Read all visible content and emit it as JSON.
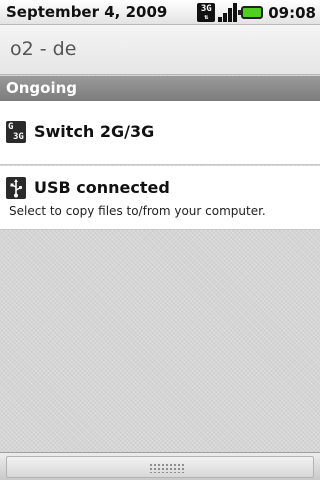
{
  "status_bar": {
    "date": "September 4, 2009",
    "time": "09:08",
    "icons": [
      "3g-data-icon",
      "signal-strength-icon",
      "battery-icon"
    ],
    "network_label": "3G",
    "battery_color": "#4fcf1f"
  },
  "carrier": {
    "name": "o2 - de"
  },
  "section": {
    "title": "Ongoing"
  },
  "notifications": [
    {
      "icon": "switch-2g3g-icon",
      "title": "Switch 2G/3G",
      "text": ""
    },
    {
      "icon": "usb-icon",
      "title": "USB connected",
      "text": "Select to copy files to/from your computer."
    }
  ],
  "icon_labels": {
    "top": "G",
    "bottom": "3G"
  }
}
